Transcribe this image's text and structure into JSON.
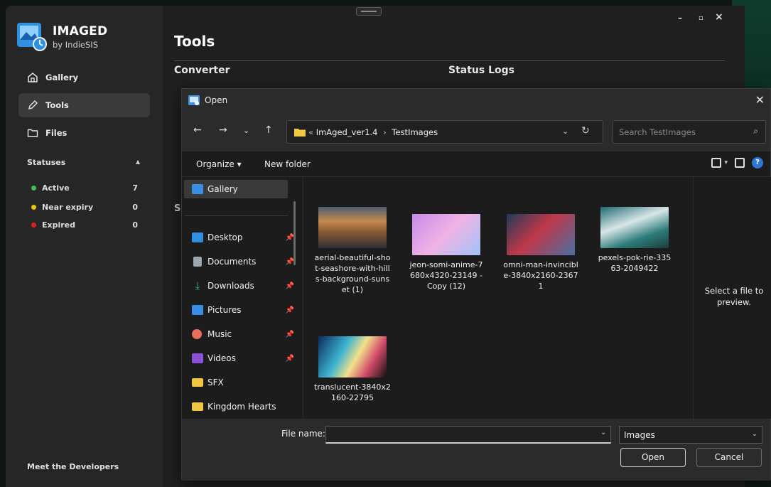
{
  "app": {
    "brand": "IMAGED",
    "brand_sub": "by IndieSIS",
    "nav": [
      {
        "label": "Gallery",
        "icon": "home-icon"
      },
      {
        "label": "Tools",
        "icon": "pen-icon",
        "active": true
      },
      {
        "label": "Files",
        "icon": "folder-icon"
      }
    ],
    "statuses_label": "Statuses",
    "statuses": [
      {
        "label": "Active",
        "count": "7",
        "color": "#3fbf4f"
      },
      {
        "label": "Near expiry",
        "count": "0",
        "color": "#f2c200"
      },
      {
        "label": "Expired",
        "count": "0",
        "color": "#e02020"
      }
    ],
    "footer_link": "Meet the Developers",
    "page_title": "Tools",
    "sections": {
      "converter": "Converter",
      "status_logs": "Status Logs",
      "hidden_section_initial": "S"
    },
    "window_controls": {
      "minimize": "–",
      "maximize": "▫",
      "close": "×"
    }
  },
  "dialog": {
    "title": "Open",
    "address": {
      "prefix": "«",
      "crumbs": [
        "ImAged_ver1.4",
        "TestImages"
      ],
      "separator": "›"
    },
    "search_placeholder": "Search TestImages",
    "commands": {
      "organize": "Organize ▾",
      "new_folder": "New folder"
    },
    "nav_pane": [
      {
        "label": "Gallery",
        "icon": "gallery-icon",
        "color": "#3a8ee6",
        "selected": true
      },
      {
        "label": "Desktop",
        "icon": "desktop-icon",
        "color": "#2f8fe0",
        "pinned": true
      },
      {
        "label": "Documents",
        "icon": "documents-icon",
        "color": "#9aa6b2",
        "pinned": true
      },
      {
        "label": "Downloads",
        "icon": "downloads-icon",
        "color": "#2fb36d",
        "pinned": true
      },
      {
        "label": "Pictures",
        "icon": "pictures-icon",
        "color": "#3a8ee6",
        "pinned": true
      },
      {
        "label": "Music",
        "icon": "music-icon",
        "color": "#e86f5a",
        "pinned": true
      },
      {
        "label": "Videos",
        "icon": "videos-icon",
        "color": "#8b4fd8",
        "pinned": true
      },
      {
        "label": "SFX",
        "icon": "folder-icon",
        "color": "#f2c744"
      },
      {
        "label": "Kingdom Hearts",
        "icon": "folder-icon",
        "color": "#f2c744"
      }
    ],
    "files": [
      {
        "name": "aerial-beautiful-shot-seashore-with-hills-background-sunset (1)",
        "thumb": "linear-gradient(180deg,#4e5d6e 0%,#c38a4e 35%,#8a5a33 60%,#2b2f36 100%)"
      },
      {
        "name": "jeon-somi-anime-7680x4320-23149 - Copy (12)",
        "thumb": "linear-gradient(135deg,#c78ae8 0%,#f0b3e6 50%,#9ec4f5 100%)"
      },
      {
        "name": "omni-man-invincible-3840x2160-23671",
        "thumb": "linear-gradient(135deg,#1f3a5a 0%,#c0384a 45%,#4a6fa0 100%)"
      },
      {
        "name": "pexels-pok-rie-33563-2049422",
        "thumb": "linear-gradient(160deg,#1e6a72 0%,#d8e6e8 40%,#2d7d7a 70%,#1b3c3a 100%)"
      },
      {
        "name": "translucent-3840x2160-22795",
        "thumb": "linear-gradient(120deg,#0d2a5a 0%,#3bb3d1 35%,#f2e08a 55%,#d24a6a 75%,#111 100%)"
      }
    ],
    "preview_text": "Select a file to preview.",
    "file_name_label": "File name:",
    "file_name_value": "",
    "file_type": "Images",
    "open_label": "Open",
    "cancel_label": "Cancel"
  }
}
